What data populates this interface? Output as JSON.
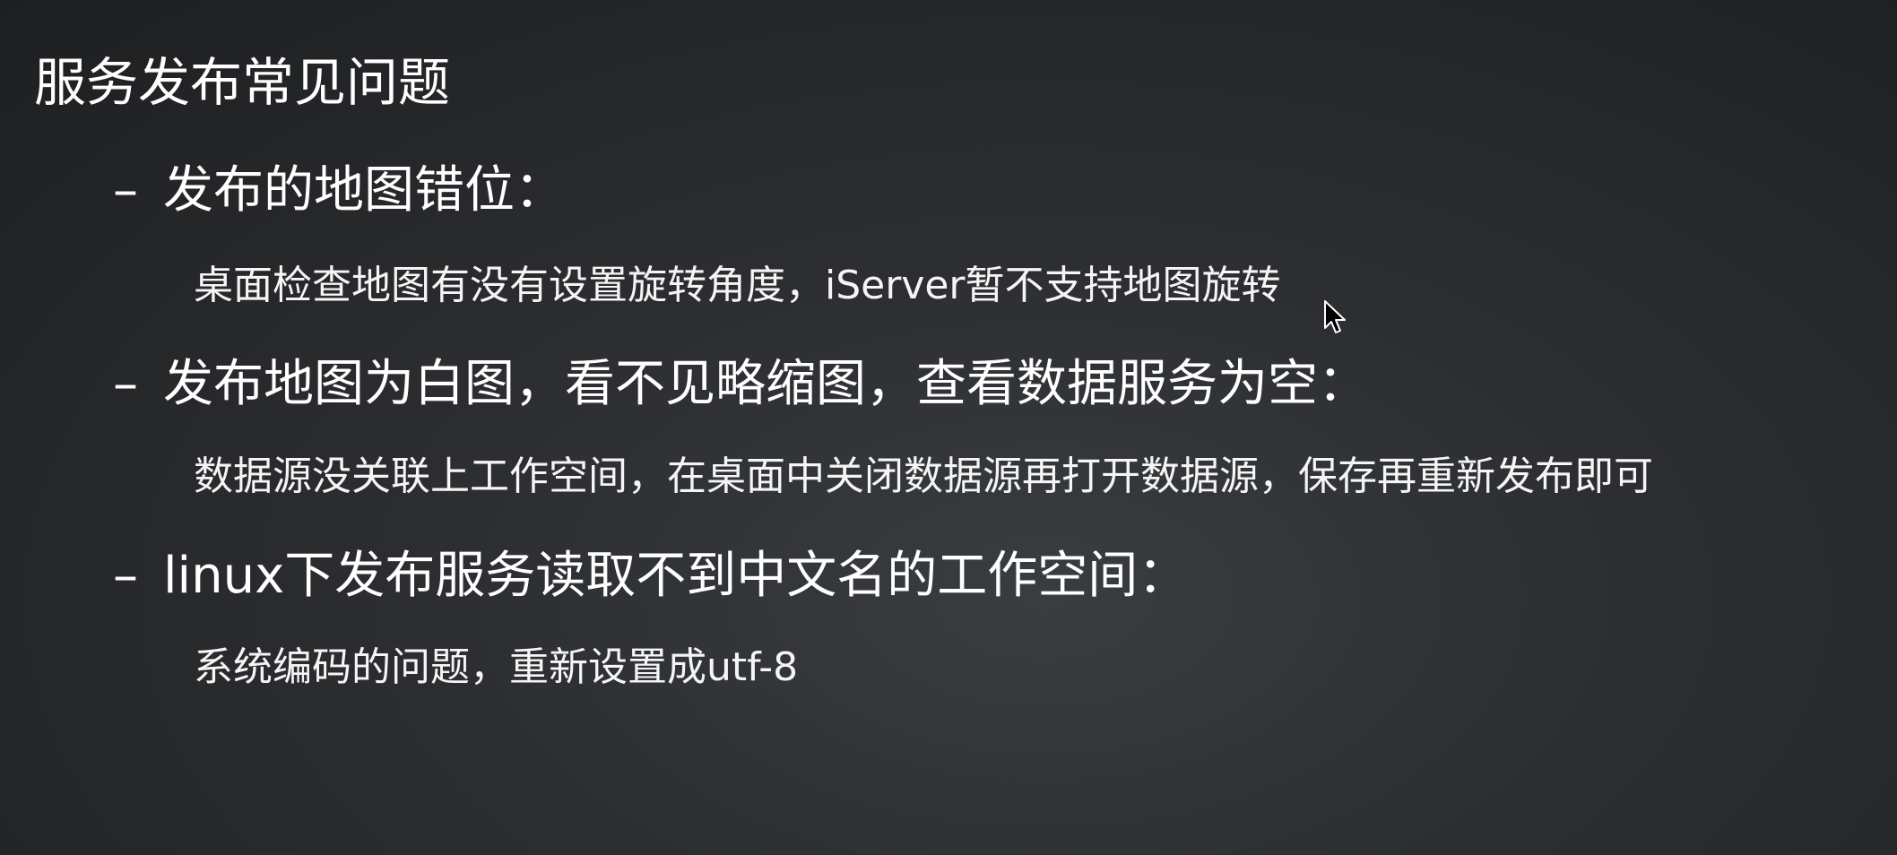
{
  "slide": {
    "title": "服务发布常见问题",
    "items": [
      {
        "marker": "–",
        "heading": "发布的地图错位：",
        "detail": "桌面检查地图有没有设置旋转角度，iServer暂不支持地图旋转"
      },
      {
        "marker": "–",
        "heading": "发布地图为白图，看不见略缩图，查看数据服务为空：",
        "detail": "数据源没关联上工作空间，在桌面中关闭数据源再打开数据源，保存再重新发布即可"
      },
      {
        "marker": "–",
        "heading": "linux下发布服务读取不到中文名的工作空间：",
        "detail": "系统编码的问题，重新设置成utf-8"
      }
    ]
  },
  "colors": {
    "text": "#ffffff",
    "background": "#2c2e31"
  },
  "icons": {
    "cursor": "mouse-pointer-icon"
  }
}
